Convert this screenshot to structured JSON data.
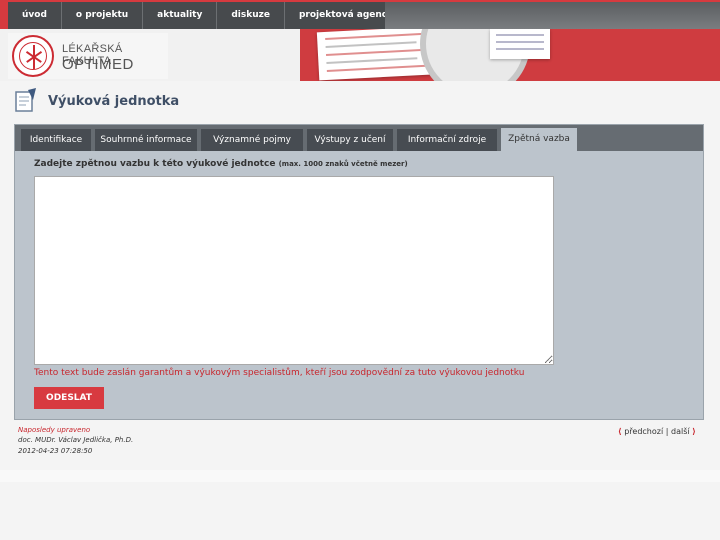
{
  "nav": {
    "items": [
      "úvod",
      "o projektu",
      "aktuality",
      "diskuze",
      "projektová agenda"
    ]
  },
  "header": {
    "faculty_line1": "LÉKAŘSKÁ FAKULTA",
    "faculty_line2": "OPTIMED"
  },
  "page": {
    "title": "Výuková jednotka"
  },
  "tabs": [
    {
      "label": "Identifikace",
      "active": false
    },
    {
      "label": "Souhrnné informace",
      "active": false
    },
    {
      "label": "Významné pojmy",
      "active": false
    },
    {
      "label": "Výstupy z učení",
      "active": false
    },
    {
      "label": "Informační zdroje",
      "active": false
    },
    {
      "label": "Zpětná vazba",
      "active": true
    }
  ],
  "form": {
    "instruction": "Zadejte zpětnou vazbu k této výukové jednotce",
    "instruction_limit": "(max. 1000 znaků včetně mezer)",
    "feedback_value": "",
    "note": "Tento text bude zaslán garantům a výukovým specialistům, kteří jsou zodpovědní za tuto výukovou jednotku",
    "submit_label": "ODESLAT"
  },
  "footer": {
    "last_modified_label": "Naposledy upraveno",
    "author": "doc. MUDr. Václav Jedlička, Ph.D.",
    "timestamp": "2012-04-23 07:28:50",
    "prev_label": "předchozí",
    "next_label": "další"
  },
  "colors": {
    "brand_red": "#d63a3f",
    "nav_dark": "#474a4d",
    "panel_bg": "#bcc4cc",
    "title_blue": "#3f4f66"
  }
}
